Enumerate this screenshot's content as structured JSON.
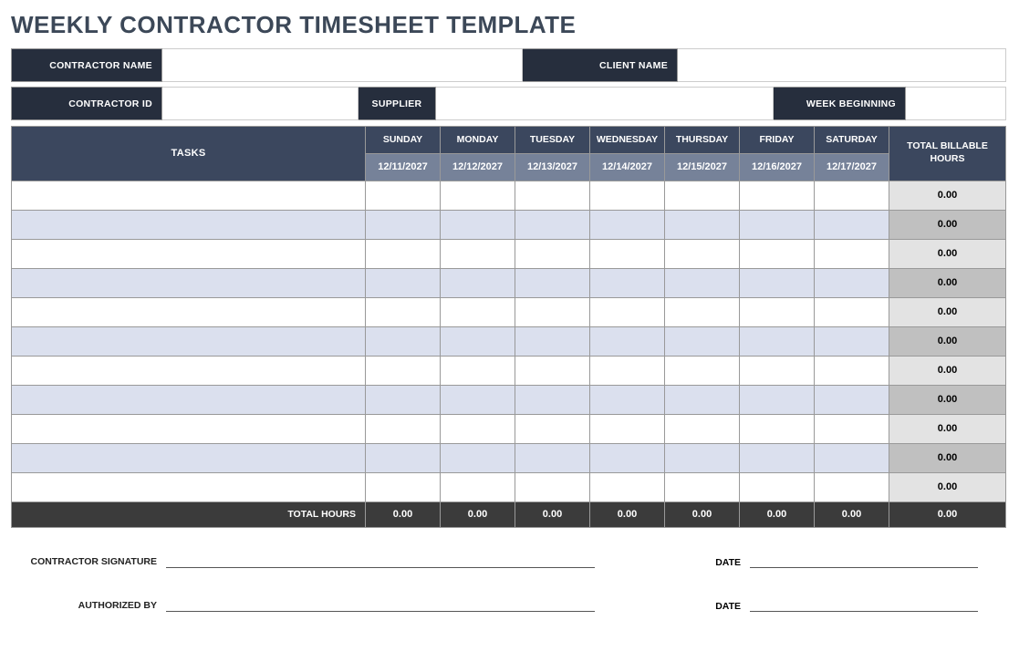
{
  "title": "WEEKLY CONTRACTOR TIMESHEET TEMPLATE",
  "info": {
    "contractor_name_label": "CONTRACTOR NAME",
    "client_name_label": "CLIENT NAME",
    "contractor_id_label": "CONTRACTOR ID",
    "supplier_label": "SUPPLIER",
    "week_beginning_label": "WEEK BEGINNING",
    "contractor_name": "",
    "client_name": "",
    "contractor_id": "",
    "supplier": "",
    "week_beginning": ""
  },
  "table": {
    "tasks_label": "TASKS",
    "total_billable_label": "TOTAL BILLABLE HOURS",
    "total_hours_label": "TOTAL HOURS",
    "days": [
      {
        "name": "SUNDAY",
        "date": "12/11/2027"
      },
      {
        "name": "MONDAY",
        "date": "12/12/2027"
      },
      {
        "name": "TUESDAY",
        "date": "12/13/2027"
      },
      {
        "name": "WEDNESDAY",
        "date": "12/14/2027"
      },
      {
        "name": "THURSDAY",
        "date": "12/15/2027"
      },
      {
        "name": "FRIDAY",
        "date": "12/16/2027"
      },
      {
        "name": "SATURDAY",
        "date": "12/17/2027"
      }
    ],
    "rows": [
      {
        "task": "",
        "hours": [
          "",
          "",
          "",
          "",
          "",
          "",
          ""
        ],
        "total": "0.00"
      },
      {
        "task": "",
        "hours": [
          "",
          "",
          "",
          "",
          "",
          "",
          ""
        ],
        "total": "0.00"
      },
      {
        "task": "",
        "hours": [
          "",
          "",
          "",
          "",
          "",
          "",
          ""
        ],
        "total": "0.00"
      },
      {
        "task": "",
        "hours": [
          "",
          "",
          "",
          "",
          "",
          "",
          ""
        ],
        "total": "0.00"
      },
      {
        "task": "",
        "hours": [
          "",
          "",
          "",
          "",
          "",
          "",
          ""
        ],
        "total": "0.00"
      },
      {
        "task": "",
        "hours": [
          "",
          "",
          "",
          "",
          "",
          "",
          ""
        ],
        "total": "0.00"
      },
      {
        "task": "",
        "hours": [
          "",
          "",
          "",
          "",
          "",
          "",
          ""
        ],
        "total": "0.00"
      },
      {
        "task": "",
        "hours": [
          "",
          "",
          "",
          "",
          "",
          "",
          ""
        ],
        "total": "0.00"
      },
      {
        "task": "",
        "hours": [
          "",
          "",
          "",
          "",
          "",
          "",
          ""
        ],
        "total": "0.00"
      },
      {
        "task": "",
        "hours": [
          "",
          "",
          "",
          "",
          "",
          "",
          ""
        ],
        "total": "0.00"
      },
      {
        "task": "",
        "hours": [
          "",
          "",
          "",
          "",
          "",
          "",
          ""
        ],
        "total": "0.00"
      }
    ],
    "totals": {
      "per_day": [
        "0.00",
        "0.00",
        "0.00",
        "0.00",
        "0.00",
        "0.00",
        "0.00"
      ],
      "grand": "0.00"
    }
  },
  "signatures": {
    "contractor_signature_label": "CONTRACTOR SIGNATURE",
    "authorized_by_label": "AUTHORIZED BY",
    "date_label": "DATE"
  }
}
